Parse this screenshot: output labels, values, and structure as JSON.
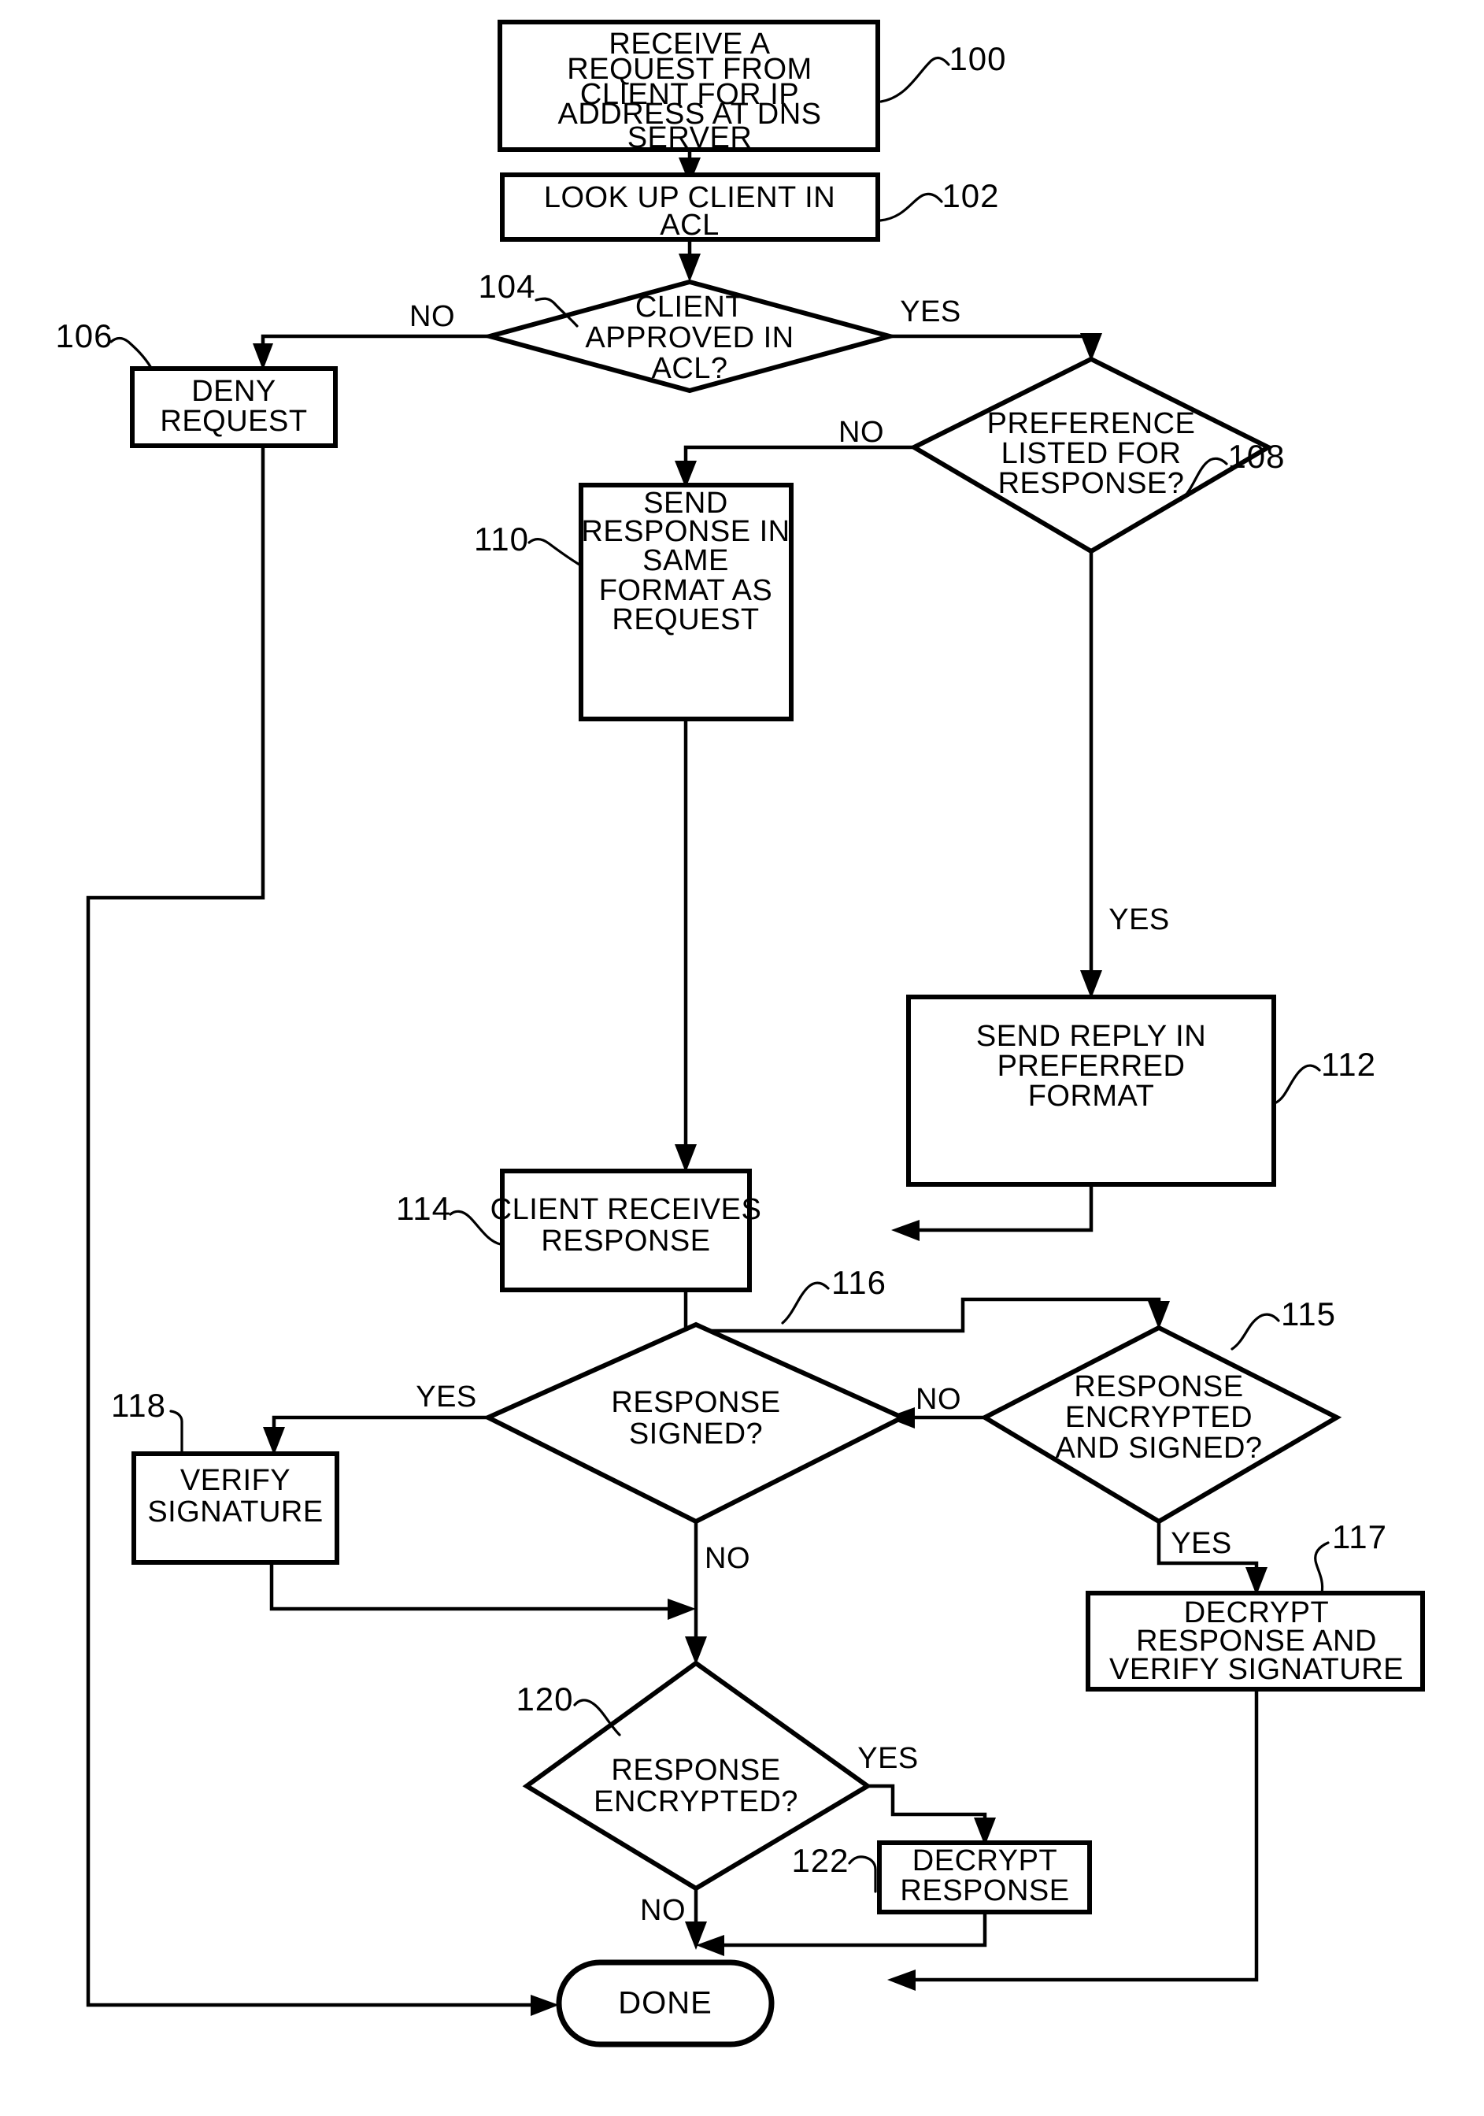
{
  "figure": {
    "type": "flowchart",
    "description": "DNS server access-control and response-format decision flowchart",
    "nodes": [
      {
        "id": "100",
        "shape": "process",
        "ref": "100",
        "lines": [
          "RECEIVE A",
          "REQUEST FROM",
          "CLIENT FOR IP",
          "ADDRESS AT DNS",
          "SERVER"
        ]
      },
      {
        "id": "102",
        "shape": "process",
        "ref": "102",
        "lines": [
          "LOOK UP CLIENT IN",
          "ACL"
        ]
      },
      {
        "id": "104",
        "shape": "decision",
        "ref": "104",
        "lines": [
          "CLIENT",
          "APPROVED IN",
          "ACL?"
        ]
      },
      {
        "id": "106",
        "shape": "process",
        "ref": "106",
        "lines": [
          "DENY",
          "REQUEST"
        ]
      },
      {
        "id": "108",
        "shape": "decision",
        "ref": "108",
        "lines": [
          "PREFERENCE",
          "LISTED FOR",
          "RESPONSE?"
        ]
      },
      {
        "id": "110",
        "shape": "process",
        "ref": "110",
        "lines": [
          "SEND",
          "RESPONSE IN",
          "SAME",
          "FORMAT AS",
          "REQUEST"
        ]
      },
      {
        "id": "112",
        "shape": "process",
        "ref": "112",
        "lines": [
          "SEND REPLY IN",
          "PREFERRED",
          "FORMAT"
        ]
      },
      {
        "id": "114",
        "shape": "process",
        "ref": "114",
        "lines": [
          "CLIENT RECEIVES",
          "RESPONSE"
        ]
      },
      {
        "id": "115",
        "shape": "decision",
        "ref": "115",
        "lines": [
          "RESPONSE",
          "ENCRYPTED",
          "AND SIGNED?"
        ]
      },
      {
        "id": "116",
        "shape": "decision",
        "ref": "116",
        "lines": [
          "RESPONSE",
          "SIGNED?"
        ]
      },
      {
        "id": "117",
        "shape": "process",
        "ref": "117",
        "lines": [
          "DECRYPT",
          "RESPONSE AND",
          "VERIFY SIGNATURE"
        ]
      },
      {
        "id": "118",
        "shape": "process",
        "ref": "118",
        "lines": [
          "VERIFY",
          "SIGNATURE"
        ]
      },
      {
        "id": "120",
        "shape": "decision",
        "ref": "120",
        "lines": [
          "RESPONSE",
          "ENCRYPTED?"
        ]
      },
      {
        "id": "122",
        "shape": "process",
        "ref": "122",
        "lines": [
          "DECRYPT",
          "RESPONSE"
        ]
      },
      {
        "id": "done",
        "shape": "terminator",
        "ref": "",
        "lines": [
          "DONE"
        ]
      }
    ],
    "branch_labels": {
      "d104_no": "NO",
      "d104_yes": "YES",
      "d108_no": "NO",
      "d108_yes": "YES",
      "d115_no": "NO",
      "d115_yes": "YES",
      "d116_yes": "YES",
      "d116_no": "NO",
      "d120_yes": "YES",
      "d120_no": "NO"
    },
    "reference_numerals": [
      "100",
      "102",
      "104",
      "106",
      "108",
      "110",
      "112",
      "114",
      "115",
      "116",
      "117",
      "118",
      "120",
      "122"
    ],
    "colors": {
      "stroke": "#000000",
      "fill": "#ffffff",
      "text": "#000000"
    }
  }
}
